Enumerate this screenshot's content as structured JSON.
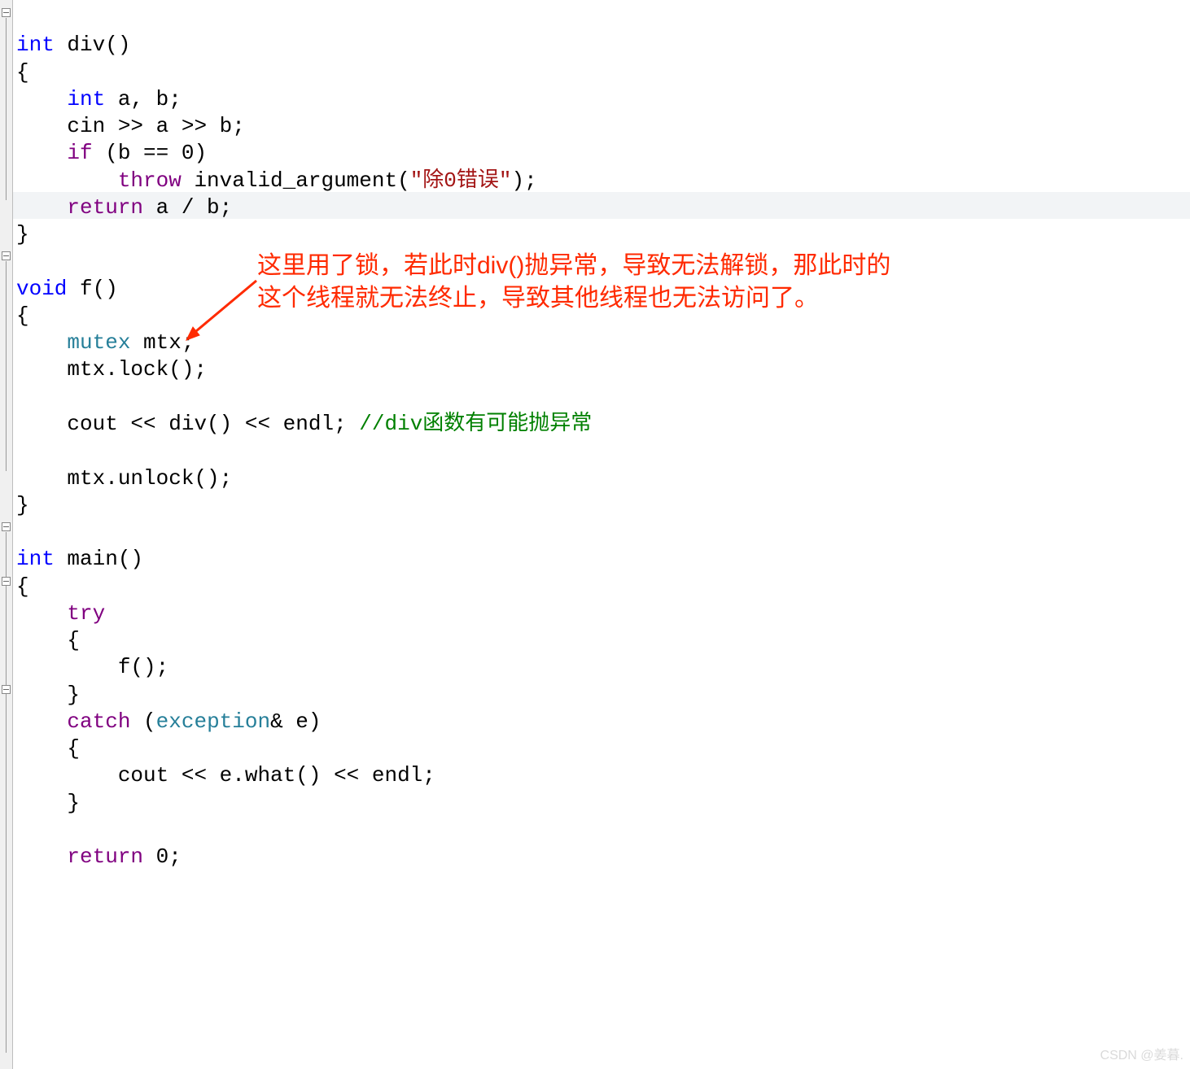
{
  "code": {
    "div_sig_int": "int",
    "div_sig_name": " div()",
    "brace_open": "{",
    "div_decl_int": "int",
    "div_decl_rest": " a, b;",
    "div_cin": "cin >> a >> b;",
    "div_if_kw": "if",
    "div_if_cond": " (b == 0)",
    "div_throw_kw": "throw",
    "div_throw_mid": " invalid_argument(",
    "div_throw_str": "\"除0错误\"",
    "div_throw_end": ");",
    "div_return_kw": "return",
    "div_return_rest": " a / b;",
    "brace_close": "}",
    "f_sig_void": "void",
    "f_sig_name": " f()",
    "f_mutex_type": "mutex",
    "f_mutex_rest": " mtx;",
    "f_lock": "mtx.lock();",
    "f_cout_pre": "cout << div() << endl; ",
    "f_cout_cmt": "//div函数有可能抛异常",
    "f_unlock": "mtx.unlock();",
    "main_sig_int": "int",
    "main_sig_name": " main()",
    "main_try_kw": "try",
    "main_try_call": "f();",
    "main_catch_kw": "catch",
    "main_catch_mid": " (",
    "main_catch_type": "exception",
    "main_catch_rest": "& e)",
    "main_catch_body": "cout << e.what() << endl;",
    "main_return_kw": "return",
    "main_return_rest": " 0;"
  },
  "annotation": {
    "line1": "这里用了锁，若此时div()抛异常，导致无法解锁，那此时的",
    "line2": "这个线程就无法终止，导致其他线程也无法访问了。"
  },
  "watermark": "CSDN @姜暮."
}
